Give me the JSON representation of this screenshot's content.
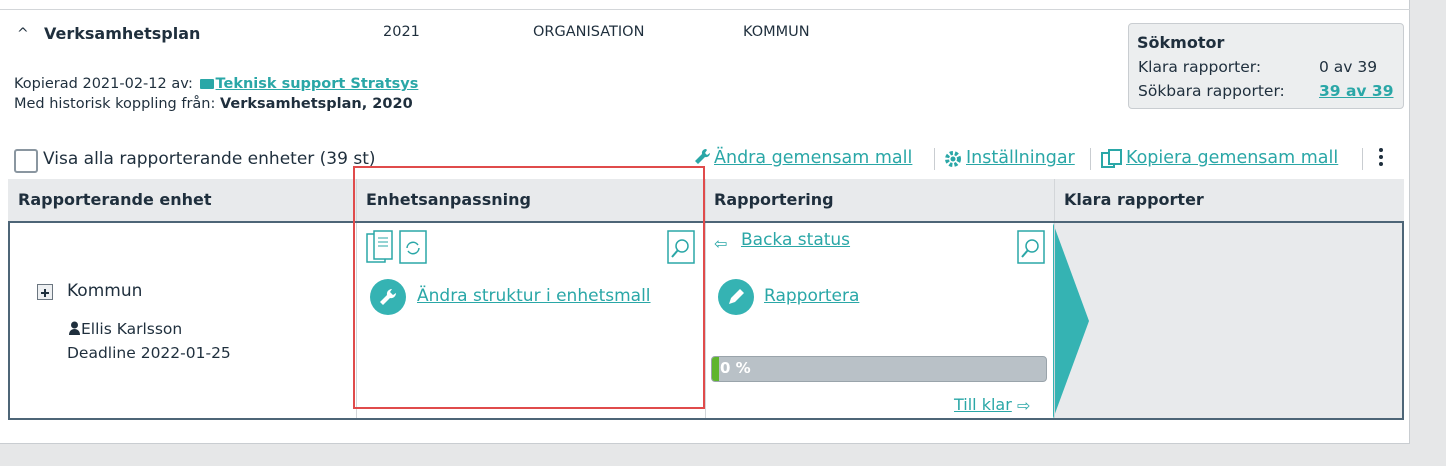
{
  "plan": {
    "title": "Verksamhetsplan",
    "year": "2021",
    "organisation": "ORGANISATION",
    "kommun": "KOMMUN",
    "copied_prefix": "Kopierad 2021-02-12 av:",
    "copied_by": "Teknisk support Stratsys",
    "history_prefix": "Med historisk koppling från:",
    "history_plan": "Verksamhetsplan, 2020"
  },
  "sokmotor": {
    "title": "Sökmotor",
    "klara_label": "Klara rapporter:",
    "klara_value": "0 av 39",
    "sokbara_label": "Sökbara rapporter:",
    "sokbara_value": "39 av 39"
  },
  "toolbar": {
    "show_all_label": "Visa alla rapporterande enheter (39 st)",
    "show_all_checked": false,
    "edit_template": "Ändra gemensam mall",
    "settings": "Inställningar",
    "copy_template": "Kopiera gemensam mall"
  },
  "table": {
    "headers": [
      "Rapporterande enhet",
      "Enhetsanpassning",
      "Rapportering",
      "Klara rapporter"
    ],
    "row": {
      "unit": "Kommun",
      "person": "Ellis Karlsson",
      "deadline": "Deadline 2022-01-25",
      "change_structure": "Ändra struktur i enhetsmall",
      "back_status": "Backa status",
      "report": "Rapportera",
      "progress_label": "0 %",
      "progress_value": 0,
      "to_done": "Till klar"
    }
  },
  "colors": {
    "accent": "#35b3b3",
    "link": "#2aa7a7",
    "highlight": "#e04b4b",
    "progress_fill": "#5fb52d"
  }
}
